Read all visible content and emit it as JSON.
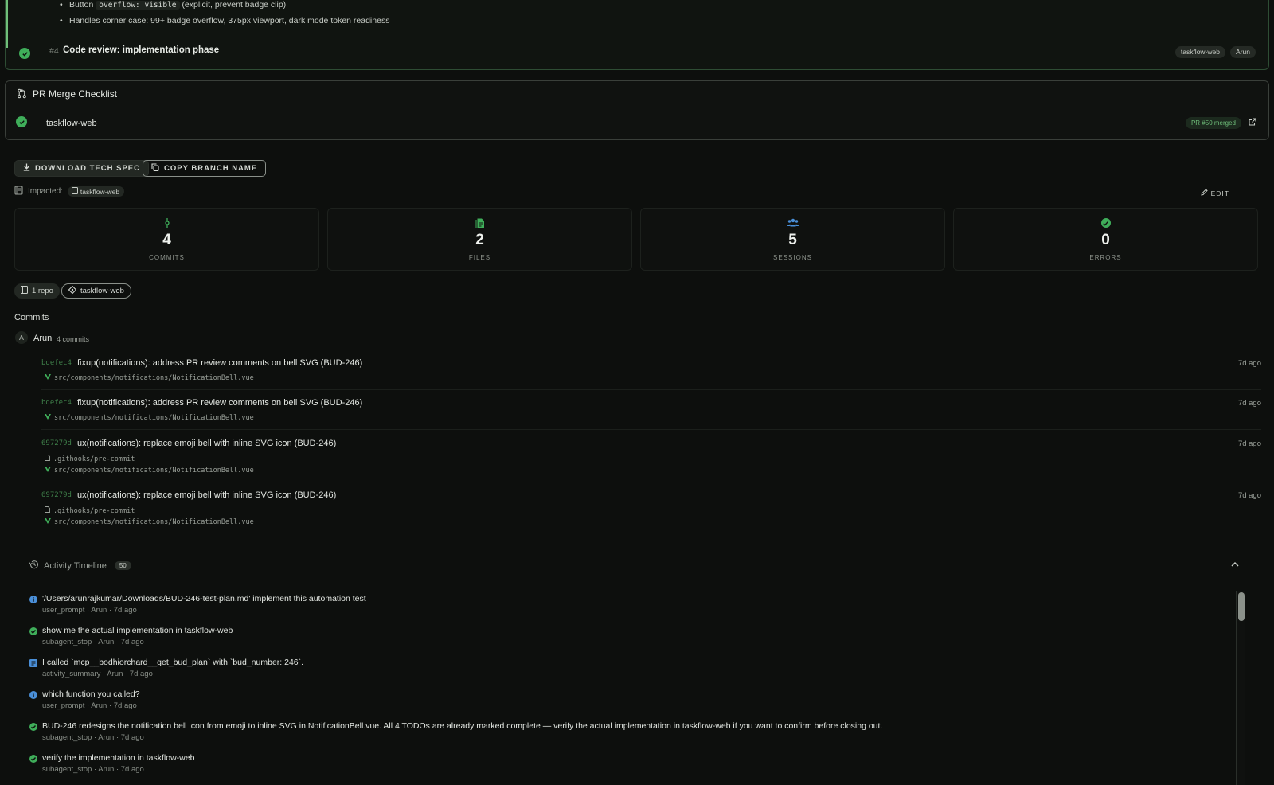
{
  "top_card": {
    "bullet1_prefix": "Button",
    "bullet1_code": "overflow: visible",
    "bullet1_suffix": "(explicit, prevent badge clip)",
    "bullet2": "Handles corner case: 99+ badge overflow, 375px viewport, dark mode token readiness",
    "todo_number": "#4",
    "todo_title": "Code review: implementation phase",
    "todo_tags": [
      "taskflow-web",
      "Arun"
    ]
  },
  "pr_checklist": {
    "title": "PR Merge Checklist",
    "repo": "taskflow-web",
    "status": "PR #50 merged"
  },
  "actions": {
    "download": "DOWNLOAD TECH SPEC",
    "copy_branch": "COPY BRANCH NAME",
    "impacted_label": "Impacted:",
    "impacted_repo": "taskflow-web",
    "edit": "EDIT"
  },
  "stats": [
    {
      "value": "4",
      "label": "COMMITS",
      "icon": "commit-icon",
      "color": "#3fae5a"
    },
    {
      "value": "2",
      "label": "FILES",
      "icon": "file-icon",
      "color": "#3fae5a"
    },
    {
      "value": "5",
      "label": "SESSIONS",
      "icon": "users-icon",
      "color": "#4a8fd8"
    },
    {
      "value": "0",
      "label": "ERRORS",
      "icon": "check-circle-icon",
      "color": "#3fae5a"
    }
  ],
  "repo_filter": {
    "count": "1 repo",
    "repo": "taskflow-web"
  },
  "commits": {
    "heading": "Commits",
    "author_initial": "A",
    "author": "Arun",
    "author_count": "4 commits",
    "items": [
      {
        "sha": "bdefec4",
        "message": "fixup(notifications): address PR review comments on bell SVG (BUD-246)",
        "when": "7d ago",
        "files": [
          "src/components/notifications/NotificationBell.vue"
        ]
      },
      {
        "sha": "bdefec4",
        "message": "fixup(notifications): address PR review comments on bell SVG (BUD-246)",
        "when": "7d ago",
        "files": [
          "src/components/notifications/NotificationBell.vue"
        ]
      },
      {
        "sha": "697279d",
        "message": "ux(notifications): replace emoji bell with inline SVG icon (BUD-246)",
        "when": "7d ago",
        "files": [
          ".githooks/pre-commit",
          "src/components/notifications/NotificationBell.vue"
        ]
      },
      {
        "sha": "697279d",
        "message": "ux(notifications): replace emoji bell with inline SVG icon (BUD-246)",
        "when": "7d ago",
        "files": [
          ".githooks/pre-commit",
          "src/components/notifications/NotificationBell.vue"
        ]
      }
    ]
  },
  "timeline": {
    "title": "Activity Timeline",
    "count": "50",
    "events": [
      {
        "type": "user_prompt",
        "text": "'/Users/arunrajkumar/Downloads/BUD-246-test-plan.md' implement this automation test",
        "meta": "user_prompt · Arun · 7d ago"
      },
      {
        "type": "subagent_stop",
        "text": "show me the actual implementation in taskflow-web",
        "meta": "subagent_stop · Arun · 7d ago"
      },
      {
        "type": "activity_summary",
        "text": "I called `mcp__bodhiorchard__get_bud_plan` with `bud_number: 246`.",
        "meta": "activity_summary · Arun · 7d ago"
      },
      {
        "type": "user_prompt",
        "text": "which function you called?",
        "meta": "user_prompt · Arun · 7d ago"
      },
      {
        "type": "subagent_stop",
        "text": "BUD-246 redesigns the notification bell icon from emoji to inline SVG in NotificationBell.vue. All 4 TODOs are already marked complete — verify the actual implementation in taskflow-web if you want to confirm before closing out.",
        "meta": "subagent_stop · Arun · 7d ago"
      },
      {
        "type": "subagent_stop",
        "text": "verify the implementation in taskflow-web",
        "meta": "subagent_stop · Arun · 7d ago"
      }
    ]
  }
}
